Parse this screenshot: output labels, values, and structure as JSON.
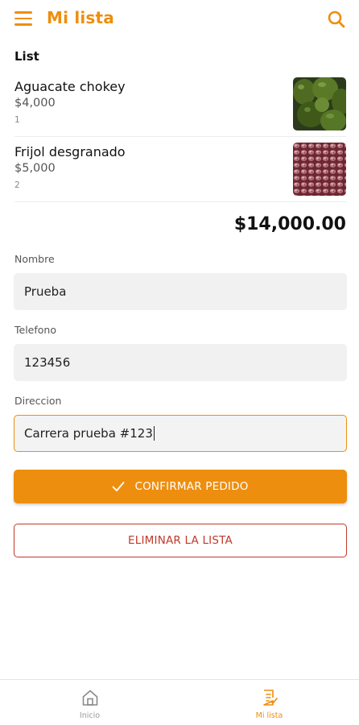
{
  "colors": {
    "accent": "#EE8E0F",
    "danger": "#C0392B"
  },
  "appbar": {
    "title": "Mi lista",
    "menu_icon": "hamburger-menu-icon",
    "search_icon": "search-icon"
  },
  "list": {
    "title": "List",
    "items": [
      {
        "name": "Aguacate chokey",
        "price": "$4,000",
        "quantity": "1",
        "image": "avocado-photo"
      },
      {
        "name": "Frijol desgranado",
        "price": "$5,000",
        "quantity": "2",
        "image": "beans-photo"
      }
    ],
    "total": "$14,000.00"
  },
  "form": {
    "nombre": {
      "label": "Nombre",
      "value": "Prueba"
    },
    "telefono": {
      "label": "Telefono",
      "value": "123456"
    },
    "direccion": {
      "label": "Direccion",
      "value": "Carrera prueba #123"
    }
  },
  "actions": {
    "confirm_label": "CONFIRMAR PEDIDO",
    "confirm_icon": "check-icon",
    "delete_label": "ELIMINAR LA LISTA"
  },
  "bottom_nav": [
    {
      "label": "Inicio",
      "icon": "home-icon",
      "active": false
    },
    {
      "label": "Mi lista",
      "icon": "list-icon",
      "active": true
    }
  ]
}
